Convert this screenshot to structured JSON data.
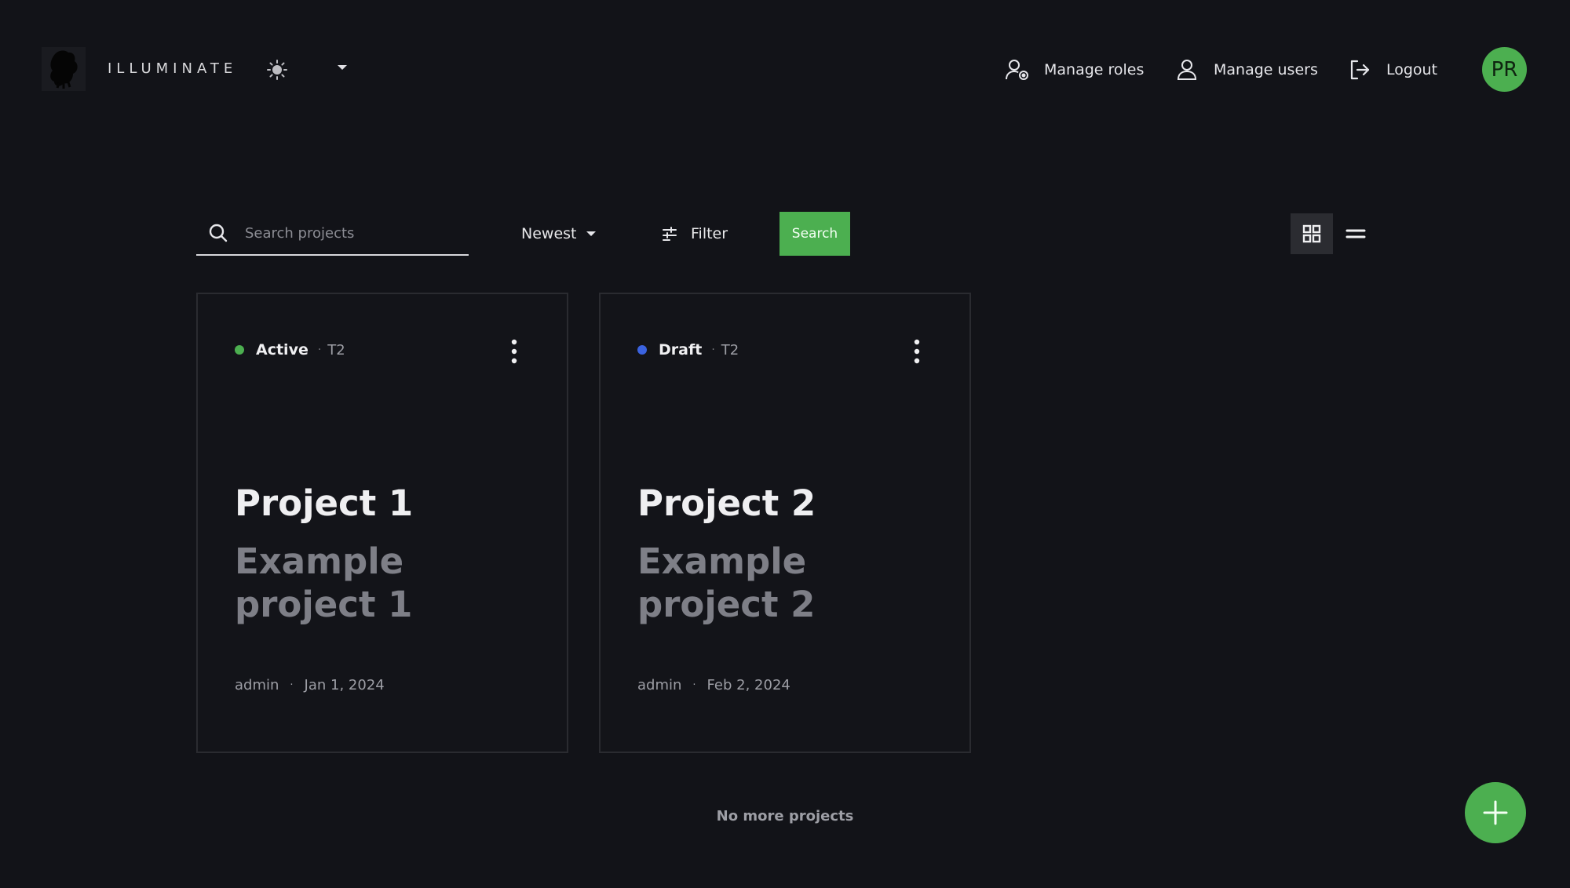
{
  "header": {
    "brand": "ILLUMINATE",
    "links": {
      "manage_roles": "Manage roles",
      "manage_users": "Manage users",
      "logout": "Logout"
    },
    "avatar_initials": "PR"
  },
  "toolbar": {
    "search_placeholder": "Search projects",
    "sort_label": "Newest",
    "filter_label": "Filter",
    "search_button": "Search"
  },
  "projects": [
    {
      "status": "Active",
      "status_color": "#4caf50",
      "tier": "T2",
      "title": "Project 1",
      "description": "Example project 1",
      "author": "admin",
      "date": "Jan 1, 2024"
    },
    {
      "status": "Draft",
      "status_color": "#3b63e0",
      "tier": "T2",
      "title": "Project 2",
      "description": "Example project 2",
      "author": "admin",
      "date": "Feb 2, 2024"
    }
  ],
  "footer": {
    "no_more": "No more projects"
  },
  "colors": {
    "background": "#121318",
    "accent": "#4caf50"
  }
}
